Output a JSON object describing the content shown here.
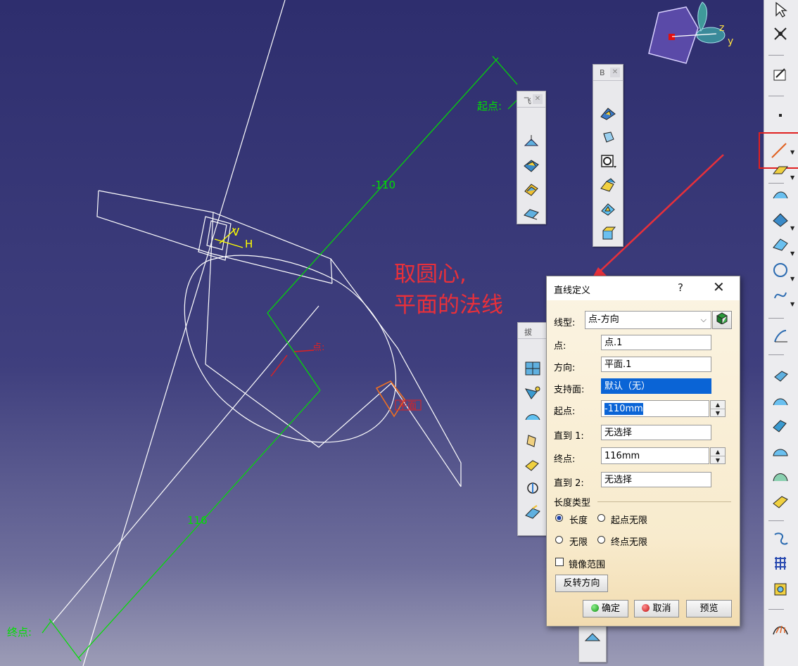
{
  "viewport": {
    "labels": {
      "start_point": "起点:",
      "end_point": "终点:",
      "dim_start": "-110",
      "dim_end": "116",
      "point_tag": "点:",
      "plane_tag": "平面",
      "axis_v": "V",
      "axis_h": "H"
    },
    "compass": {
      "z": "z",
      "y": "y"
    },
    "annotation": "取圆心,\n平面的法线"
  },
  "floating_toolbars": {
    "tb1": {
      "title": "飞"
    },
    "tb2": {
      "title": "B"
    },
    "tb3": {
      "title": "拔"
    }
  },
  "dialog": {
    "title": "直线定义",
    "help": "?",
    "close": "✕",
    "line_type_label": "线型:",
    "line_type_value": "点-方向",
    "point_label": "点:",
    "point_value": "点.1",
    "direction_label": "方向:",
    "direction_value": "平面.1",
    "support_label": "支持面:",
    "support_value": "默认（无）",
    "start_label": "起点:",
    "start_value": "-110mm",
    "upto1_label": "直到 1:",
    "upto1_value": "无选择",
    "end_label": "终点:",
    "end_value": "116mm",
    "upto2_label": "直到 2:",
    "upto2_value": "无选择",
    "length_type_label": "长度类型",
    "opt_length": "长度",
    "opt_start_infinite": "起点无限",
    "opt_infinite": "无限",
    "opt_end_infinite": "终点无限",
    "selected_length_type": "长度",
    "mirror_label": "镜像范围",
    "mirror_checked": false,
    "reverse_button": "反转方向",
    "ok_button": "确定",
    "cancel_button": "取消",
    "preview_button": "预览"
  },
  "colors": {
    "viewport_top": "#2e2e6e",
    "dimension_green": "#00e000",
    "annotation_red": "#e8303a",
    "highlight_box": "#e02020",
    "selection_blue": "#0a64d6"
  }
}
